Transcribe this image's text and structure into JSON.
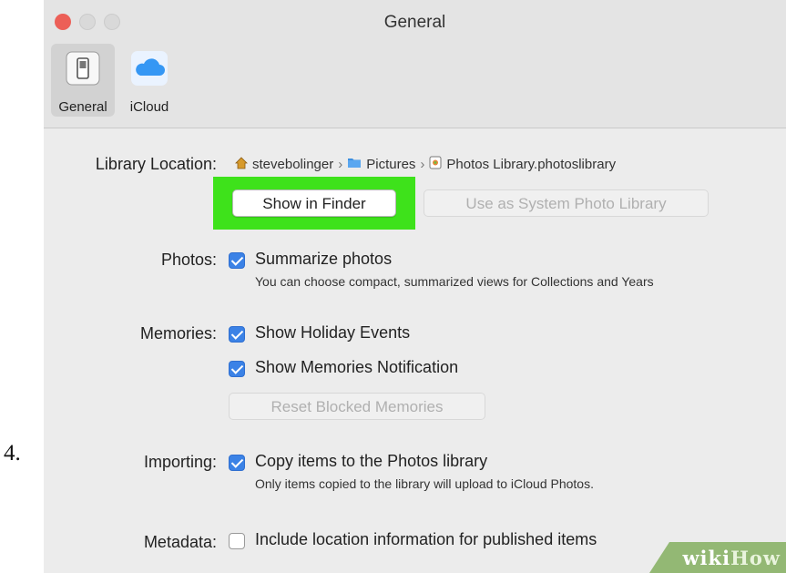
{
  "step_number": "4.",
  "window": {
    "title": "General",
    "toolbar": [
      {
        "label": "General",
        "icon": "general-switch-icon",
        "selected": true
      },
      {
        "label": "iCloud",
        "icon": "icloud-icon",
        "selected": false
      }
    ]
  },
  "library_location": {
    "label": "Library Location:",
    "path": [
      {
        "name": "stevebolinger",
        "icon": "home-icon"
      },
      {
        "name": "Pictures",
        "icon": "folder-icon"
      },
      {
        "name": "Photos Library.photoslibrary",
        "icon": "photos-library-icon"
      }
    ],
    "separator": "›",
    "show_in_finder": "Show in Finder",
    "use_as_system": "Use as System Photo Library",
    "highlight_color": "#3ee21b"
  },
  "photos": {
    "label": "Photos:",
    "summarize": "Summarize photos",
    "summarize_checked": true,
    "summarize_desc": "You can choose compact, summarized views for Collections and Years"
  },
  "memories": {
    "label": "Memories:",
    "holiday": "Show Holiday Events",
    "holiday_checked": true,
    "notification": "Show Memories Notification",
    "notification_checked": true,
    "reset": "Reset Blocked Memories"
  },
  "importing": {
    "label": "Importing:",
    "copy": "Copy items to the Photos library",
    "copy_checked": true,
    "copy_desc": "Only items copied to the library will upload to iCloud Photos."
  },
  "metadata": {
    "label": "Metadata:",
    "location": "Include location information for published items",
    "location_checked": false
  },
  "watermark": {
    "wiki": "wiki",
    "how": "How"
  },
  "colors": {
    "accent": "#3b82e6",
    "close": "#ec5f57",
    "watermark": "#93b874"
  }
}
